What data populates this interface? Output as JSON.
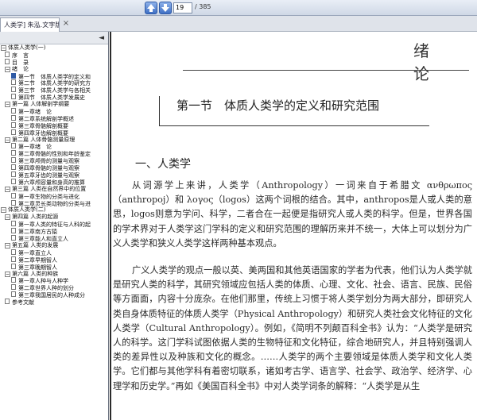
{
  "toolbar": {
    "page_current": "19",
    "page_total": "/ 385"
  },
  "tab": {
    "title": "人类学] 朱泓.文字版",
    "close": "×"
  },
  "sidebar": {
    "collapse_arrow": "◄",
    "items": [
      {
        "text": "体质人类学(一)",
        "level": 0,
        "toggle": "−"
      },
      {
        "text": "序　言",
        "level": 1,
        "doc": true
      },
      {
        "text": "目　录",
        "level": 1,
        "doc": true
      },
      {
        "text": "绪　论",
        "level": 1,
        "toggle": "−"
      },
      {
        "text": "第一节　体质人类学的定义和",
        "level": 2,
        "doc": true,
        "on": true
      },
      {
        "text": "第二节　体质人类学的研究方",
        "level": 2,
        "doc": true
      },
      {
        "text": "第三节　体质人类学与各相关",
        "level": 2,
        "doc": true
      },
      {
        "text": "第四节　体质人类学发展史",
        "level": 2,
        "doc": true
      },
      {
        "text": "第一篇 人体解剖学纲要",
        "level": 1,
        "toggle": "−"
      },
      {
        "text": "第一章绪　论",
        "level": 2,
        "doc": true
      },
      {
        "text": "第二章系统解剖学概述",
        "level": 2,
        "doc": true
      },
      {
        "text": "第三章骨骼解剖概要",
        "level": 2,
        "doc": true
      },
      {
        "text": "第四章牙齿解剖概要",
        "level": 2,
        "doc": true
      },
      {
        "text": "第二篇 人体骨骼测量原理",
        "level": 1,
        "toggle": "−"
      },
      {
        "text": "第一章绪　论",
        "level": 2,
        "doc": true
      },
      {
        "text": "第二章骨骼的性别和年龄鉴定",
        "level": 2,
        "doc": true
      },
      {
        "text": "第三章颅骨的测量与观察",
        "level": 2,
        "doc": true
      },
      {
        "text": "第四章骨骼的测量与观察",
        "level": 2,
        "doc": true
      },
      {
        "text": "第五章牙齿的测量与观察",
        "level": 2,
        "doc": true
      },
      {
        "text": "第六章颅容量和身高的推算",
        "level": 2,
        "doc": true
      },
      {
        "text": "第三篇 人类在自然界中的位置",
        "level": 1,
        "toggle": "−"
      },
      {
        "text": "第一章生物的分类与进化",
        "level": 2,
        "doc": true
      },
      {
        "text": "第二章灵长类动物的分类与进",
        "level": 2,
        "doc": true
      },
      {
        "text": "体质人类学(二)",
        "level": 0,
        "toggle": "−"
      },
      {
        "text": "第四篇 人类的起源",
        "level": 1,
        "toggle": "−"
      },
      {
        "text": "第一章人类的特征与人科的起",
        "level": 2,
        "doc": true
      },
      {
        "text": "第二章南方古猿",
        "level": 2,
        "doc": true
      },
      {
        "text": "第三章能人和直立人",
        "level": 2,
        "doc": true
      },
      {
        "text": "第五篇 人类的发展",
        "level": 1,
        "toggle": "−"
      },
      {
        "text": "第一章直立人",
        "level": 2,
        "doc": true
      },
      {
        "text": "第二章早期智人",
        "level": 2,
        "doc": true
      },
      {
        "text": "第三章晚期智人",
        "level": 2,
        "doc": true
      },
      {
        "text": "第六篇 人类的种族",
        "level": 1,
        "toggle": "−"
      },
      {
        "text": "第一章人种与人种学",
        "level": 2,
        "doc": true
      },
      {
        "text": "第二章世界人种的划分",
        "level": 2,
        "doc": true
      },
      {
        "text": "第三章我国居民的人种成分",
        "level": 2,
        "doc": true
      },
      {
        "text": "参考文献",
        "level": 1,
        "doc": true
      }
    ]
  },
  "document": {
    "chapter": "绪　论",
    "section_title": "第一节　体质人类学的定义和研究范围",
    "heading": "一、人类学",
    "para1": "从词源学上来讲，人类学（Anthropology）一词来自于希腊文 ανθρωπος（anthropoj）和 λογος（logos）这两个词根的结合。其中，anthropos是人或人类的意思，logos则意为学问、科学，二者合在一起便是指研究人或人类的科学。但是，世界各国的学术界对于人类学这门学科的定义和研究范围的理解历来并不统一，大体上可以划分为广义人类学和狭义人类学这样两种基本观点。",
    "para2": "广义人类学的观点一般以英、美两国和其他英语国家的学者为代表，他们认为人类学就是研究人类的科学，其研究领域应包括人类的体质、心理、文化、社会、语言、民族、民俗等方面面，内容十分庞杂。在他们那里，传统上习惯于将人类学划分为两大部分，即研究人类自身体质特征的体质人类学（Physical Anthropology）和研究人类社会文化特征的文化人类学（Cultural Anthropology）。例如，《简明不列颠百科全书》认为：“人类学是研究人的科学。这门学科试图依据人类的生物特征和文化特征，综合地研究人，并且特别强调人类的差异性以及种族和文化的概念。……人类学的两个主要领域是体质人类学和文化人类学。它们都与其他学科有着密切联系，诸如考古学、语言学、社会学、政治学、经济学、心理学和历史学。”再如《美国百科全书》中对人类学词条的解释：“人类学是从生"
  }
}
